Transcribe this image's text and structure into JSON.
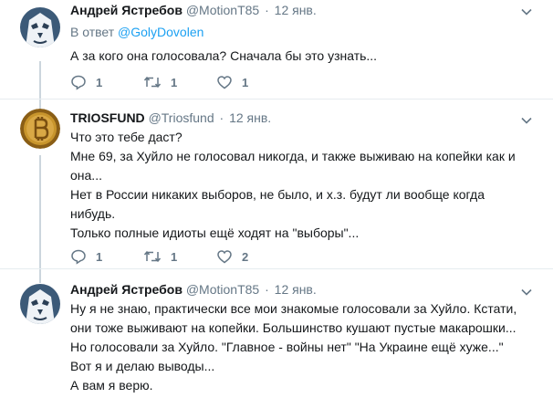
{
  "tweets": [
    {
      "name": "Андрей Ястребов",
      "handle": "@MotionT85",
      "separator": "·",
      "time": "12 янв.",
      "reply_prefix": "В ответ",
      "reply_handle": "@GolyDovolen",
      "lines": [
        "А за кого она голосовала? Сначала бы это узнать..."
      ],
      "replies": "1",
      "retweets": "1",
      "likes": "1",
      "avatar_icon": "lion-avatar-icon"
    },
    {
      "name": "TRIOSFUND",
      "handle": "@Triosfund",
      "separator": "·",
      "time": "12 янв.",
      "lines": [
        "Что это тебе даст?",
        "Мне 69, за Хуйло не голосовал никогда, и также выживаю на копейки как и",
        "она...",
        "Нет в России никаких выборов, не было, и х.з. будут ли вообще когда",
        "нибудь.",
        "Только полные идиоты ещё ходят на \"выборы\"..."
      ],
      "replies": "1",
      "retweets": "1",
      "likes": "2",
      "avatar_icon": "bitcoin-avatar-icon"
    },
    {
      "name": "Андрей Ястребов",
      "handle": "@MotionT85",
      "separator": "·",
      "time": "12 янв.",
      "lines": [
        "Ну я не знаю, практически все мои знакомые голосовали за Хуйло. Кстати,",
        "они тоже выживают на копейки. Большинство кушают пустые макарошки...",
        "Но голосовали за Хуйло. \"Главное - войны нет\" \"На Украине ещё хуже...\"",
        "Вот я и делаю выводы...",
        "А вам я верю."
      ],
      "avatar_icon": "lion-avatar-icon"
    }
  ],
  "colors": {
    "link": "#1da1f2",
    "muted": "#657786",
    "thread_line": "#ccd6dd",
    "bitcoin_gold": "#c8952c"
  }
}
